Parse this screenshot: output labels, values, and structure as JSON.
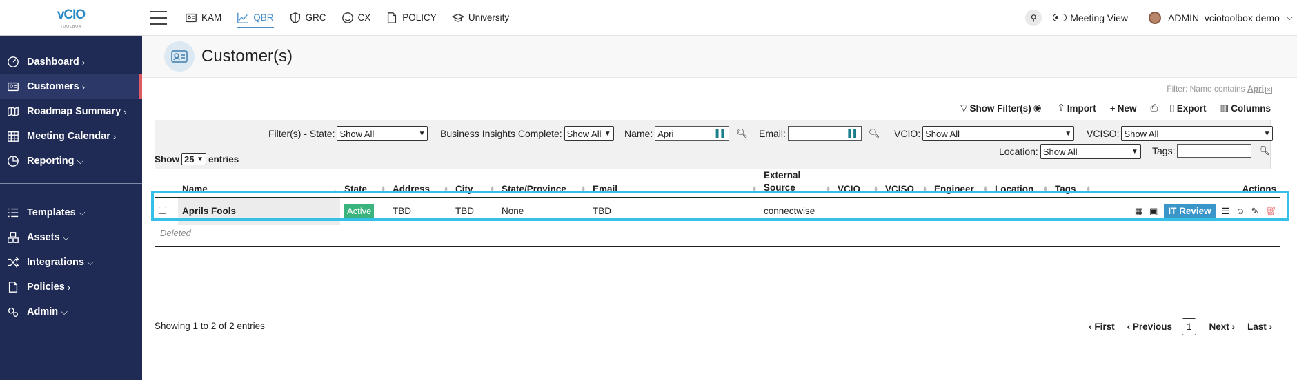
{
  "logo": {
    "main": "vCIO",
    "sub": "TOOLBOX"
  },
  "sidebar": {
    "items": [
      {
        "label": "Dashboard",
        "chev": "›"
      },
      {
        "label": "Customers",
        "chev": "›"
      },
      {
        "label": "Roadmap Summary",
        "chev": "›"
      },
      {
        "label": "Meeting Calendar",
        "chev": "›"
      },
      {
        "label": "Reporting",
        "chev": "⌵"
      },
      {
        "label": "Templates",
        "chev": "⌵"
      },
      {
        "label": "Assets",
        "chev": "⌵"
      },
      {
        "label": "Integrations",
        "chev": "⌵"
      },
      {
        "label": "Policies",
        "chev": "›"
      },
      {
        "label": "Admin",
        "chev": "⌵"
      }
    ]
  },
  "topnav": {
    "items": [
      "KAM",
      "QBR",
      "GRC",
      "CX",
      "POLICY",
      "University"
    ],
    "meeting_view": "Meeting View",
    "user": "ADMIN_vciotoolbox demo",
    "search_glyph": "⚲"
  },
  "page": {
    "title": "Customer(s)"
  },
  "filter_note": {
    "prefix": "Filter: Name contains ",
    "value": "Apri"
  },
  "toolbar": {
    "show_filters": "Show Filter(s)",
    "import": "Import",
    "new": "New",
    "export": "Export",
    "columns": "Columns"
  },
  "filters": {
    "state_label": "Filter(s) - State:",
    "state_value": "Show All",
    "bi_label": "Business Insights Complete:",
    "bi_value": "Show All",
    "name_label": "Name:",
    "name_value": "Apri",
    "email_label": "Email:",
    "email_value": "",
    "vcio_label": "VCIO:",
    "vcio_value": "Show All",
    "vciso_label": "VCISO:",
    "vciso_value": "Show All",
    "location_label": "Location:",
    "location_value": "Show All",
    "tags_label": "Tags:",
    "tags_value": ""
  },
  "entries": {
    "show": "Show",
    "count": "25",
    "suffix": "entries"
  },
  "table": {
    "headers": [
      "Name",
      "State",
      "Address",
      "City",
      "State/Province",
      "Email",
      "External Source",
      "VCIO",
      "VCISO",
      "Engineer",
      "Location",
      "Tags",
      "Actions"
    ],
    "row": {
      "name": "Aprils Fools",
      "state": "Active",
      "address": "TBD",
      "city": "TBD",
      "province": "None",
      "email": "TBD",
      "source": "connectwise",
      "it_review": "IT Review"
    },
    "deleted": "Deleted"
  },
  "footer": {
    "info": "Showing 1 to 2 of 2 entries",
    "first": "First",
    "previous": "Previous",
    "page": "1",
    "next": "Next",
    "last": "Last"
  }
}
